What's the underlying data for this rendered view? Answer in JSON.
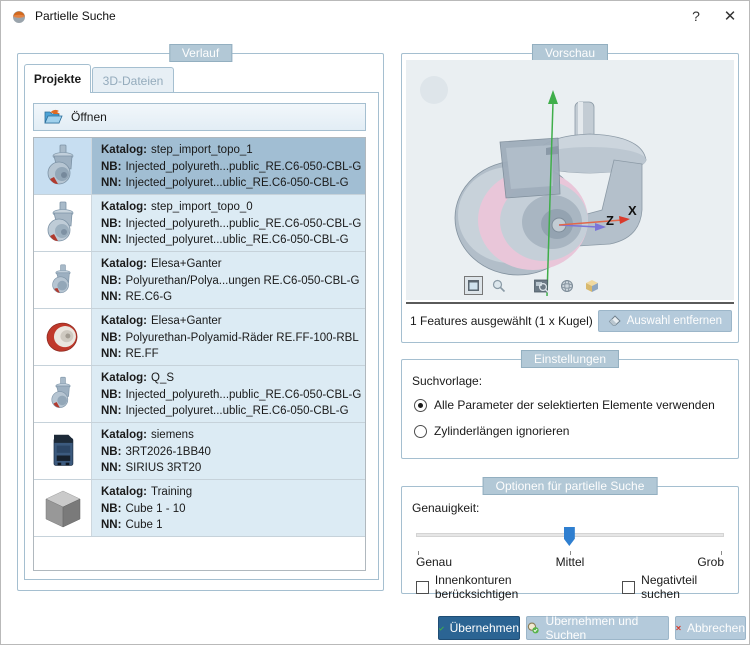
{
  "window": {
    "title": "Partielle Suche",
    "help_button": "?",
    "close_button": "✕"
  },
  "verlauf": {
    "group_label": "Verlauf",
    "tabs": {
      "projekte": "Projekte",
      "dateien3d": "3D-Dateien"
    },
    "open_button": "Öffnen",
    "labels": {
      "katalog": "Katalog:",
      "nb": "NB:",
      "nn": "NN:"
    },
    "items": [
      {
        "katalog": "step_import_topo_1",
        "nb": "Injected_polyureth...public_RE.C6-050-CBL-G",
        "nn": "Injected_polyuret...ublic_RE.C6-050-CBL-G"
      },
      {
        "katalog": "step_import_topo_0",
        "nb": "Injected_polyureth...public_RE.C6-050-CBL-G",
        "nn": "Injected_polyuret...ublic_RE.C6-050-CBL-G"
      },
      {
        "katalog": "Elesa+Ganter",
        "nb": "Polyurethan/Polya...ungen RE.C6-050-CBL-G",
        "nn": "RE.C6-G"
      },
      {
        "katalog": "Elesa+Ganter",
        "nb": "Polyurethan-Polyamid-Räder RE.FF-100-RBL",
        "nn": "RE.FF"
      },
      {
        "katalog": "Q_S",
        "nb": "Injected_polyureth...public_RE.C6-050-CBL-G",
        "nn": "Injected_polyuret...ublic_RE.C6-050-CBL-G"
      },
      {
        "katalog": "siemens",
        "nb": "3RT2026-1BB40",
        "nn": "SIRIUS 3RT20"
      },
      {
        "katalog": "Training",
        "nb": "Cube 1 - 10",
        "nn": "Cube 1"
      }
    ]
  },
  "vorschau": {
    "group_label": "Vorschau",
    "axis_z": "Z",
    "axis_x": "X",
    "status": "1 Features ausgewählt (1 x Kugel)",
    "remove_button": "Auswahl entfernen"
  },
  "einstellungen": {
    "group_label": "Einstellungen",
    "suchvorlage_label": "Suchvorlage:",
    "radio_all_params": "Alle Parameter der selektierten Elemente verwenden",
    "radio_ignore_cylinders": "Zylinderlängen ignorieren"
  },
  "optionen": {
    "group_label": "Optionen für partielle Suche",
    "genauigkeit_label": "Genauigkeit:",
    "slider_value": "Mittel",
    "tick_genau": "Genau",
    "tick_mittel": "Mittel",
    "tick_grob": "Grob",
    "checkbox_innenkonturen": "Innenkonturen berücksichtigen",
    "checkbox_negativteil": "Negativteil suchen"
  },
  "footer": {
    "apply_button": "Übernehmen",
    "apply_search_button": "Übernehmen und Suchen",
    "cancel_button": "Abbrechen"
  },
  "colors": {
    "selected_row_bg": "#a1bed3",
    "row_bg": "#dcebf4",
    "group_badge_bg": "#b2c8d6",
    "accent_button_bg": "#2b6493",
    "light_button_bg": "#b4cadb",
    "selection_highlight_pink": "#e9c6d9",
    "slider_thumb_blue": "#2f7fd0"
  }
}
